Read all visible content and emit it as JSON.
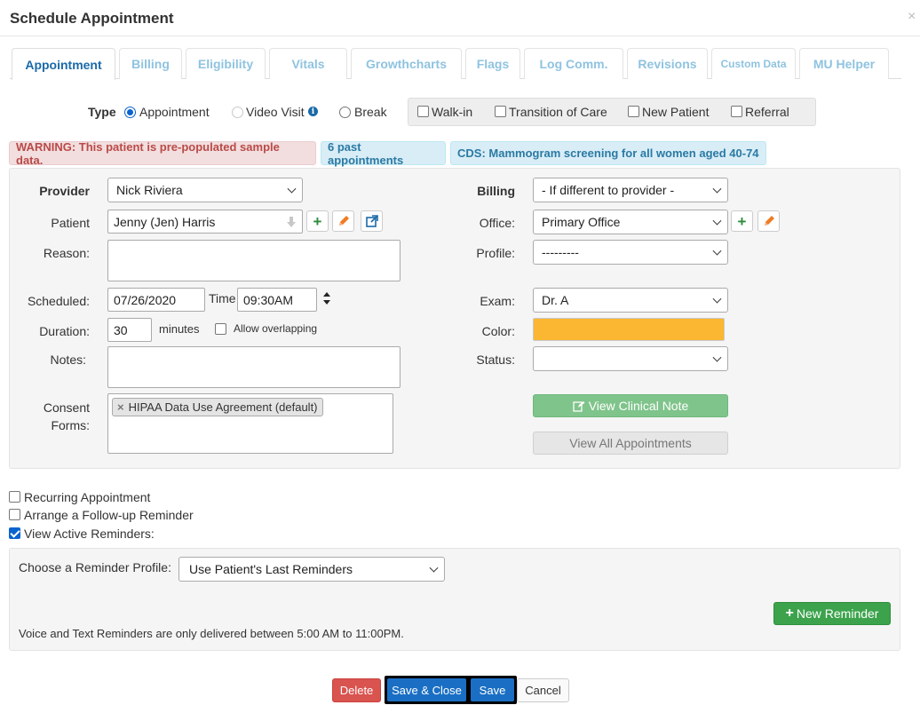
{
  "window": {
    "title": "Schedule Appointment",
    "close_glyph": "×"
  },
  "tabs": [
    {
      "label": "Appointment"
    },
    {
      "label": "Billing"
    },
    {
      "label": "Eligibility"
    },
    {
      "label": "Vitals"
    },
    {
      "label": "Growthcharts"
    },
    {
      "label": "Flags"
    },
    {
      "label": "Log Comm."
    },
    {
      "label": "Revisions"
    },
    {
      "label": "Custom Data"
    },
    {
      "label": "MU Helper"
    }
  ],
  "type_row": {
    "label": "Type",
    "options": [
      {
        "label": "Appointment",
        "checked": true
      },
      {
        "label": "Video Visit",
        "checked": false
      },
      {
        "label": "Break",
        "checked": false
      }
    ],
    "info_icon": "i",
    "checkboxes": [
      {
        "label": "Walk-in",
        "checked": false
      },
      {
        "label": "Transition of Care",
        "checked": false
      },
      {
        "label": "New Patient",
        "checked": false
      },
      {
        "label": "Referral",
        "checked": false
      }
    ]
  },
  "alerts": {
    "warning": "WARNING: This patient is pre-populated sample data.",
    "past": "6 past appointments",
    "cds": "CDS: Mammogram screening for all women aged 40-74"
  },
  "form": {
    "provider_label": "Provider",
    "provider_value": "Nick Riviera",
    "patient_label": "Patient",
    "patient_value": "Jenny (Jen) Harris",
    "reason_label": "Reason:",
    "scheduled_label": "Scheduled:",
    "scheduled_value": "07/26/2020",
    "time_label": "Time",
    "time_value": "09:30AM",
    "duration_label": "Duration:",
    "duration_value": "30",
    "minutes_label": "minutes",
    "allow_overlap_label": "Allow overlapping",
    "notes_label": "Notes:",
    "consent_label_1": "Consent",
    "consent_label_2": "Forms:",
    "consent_tag_remove": "×",
    "consent_tag": "HIPAA Data Use Agreement (default)",
    "billing_label": "Billing",
    "billing_value": "- If different to provider -",
    "office_label": "Office:",
    "office_value": "Primary Office",
    "profile_label": "Profile:",
    "profile_value": "---------",
    "exam_label": "Exam:",
    "exam_value": "Dr. A",
    "color_label": "Color:",
    "color_value": "#fbb731",
    "status_label": "Status:",
    "status_value": "",
    "view_note_label": "View Clinical Note",
    "view_all_label": "View All Appointments"
  },
  "options": {
    "recurring": "Recurring Appointment",
    "followup": "Arrange a Follow-up Reminder",
    "active_reminders": "View Active Reminders:",
    "active_reminders_checked": true
  },
  "reminders": {
    "profile_label": "Choose a Reminder Profile:",
    "profile_value": "Use Patient's Last Reminders",
    "new_reminder_label": "New Reminder",
    "note": "Voice and Text Reminders are only delivered between 5:00 AM to 11:00PM."
  },
  "footer": {
    "delete": "Delete",
    "save_close": "Save & Close",
    "save": "Save",
    "cancel": "Cancel"
  }
}
